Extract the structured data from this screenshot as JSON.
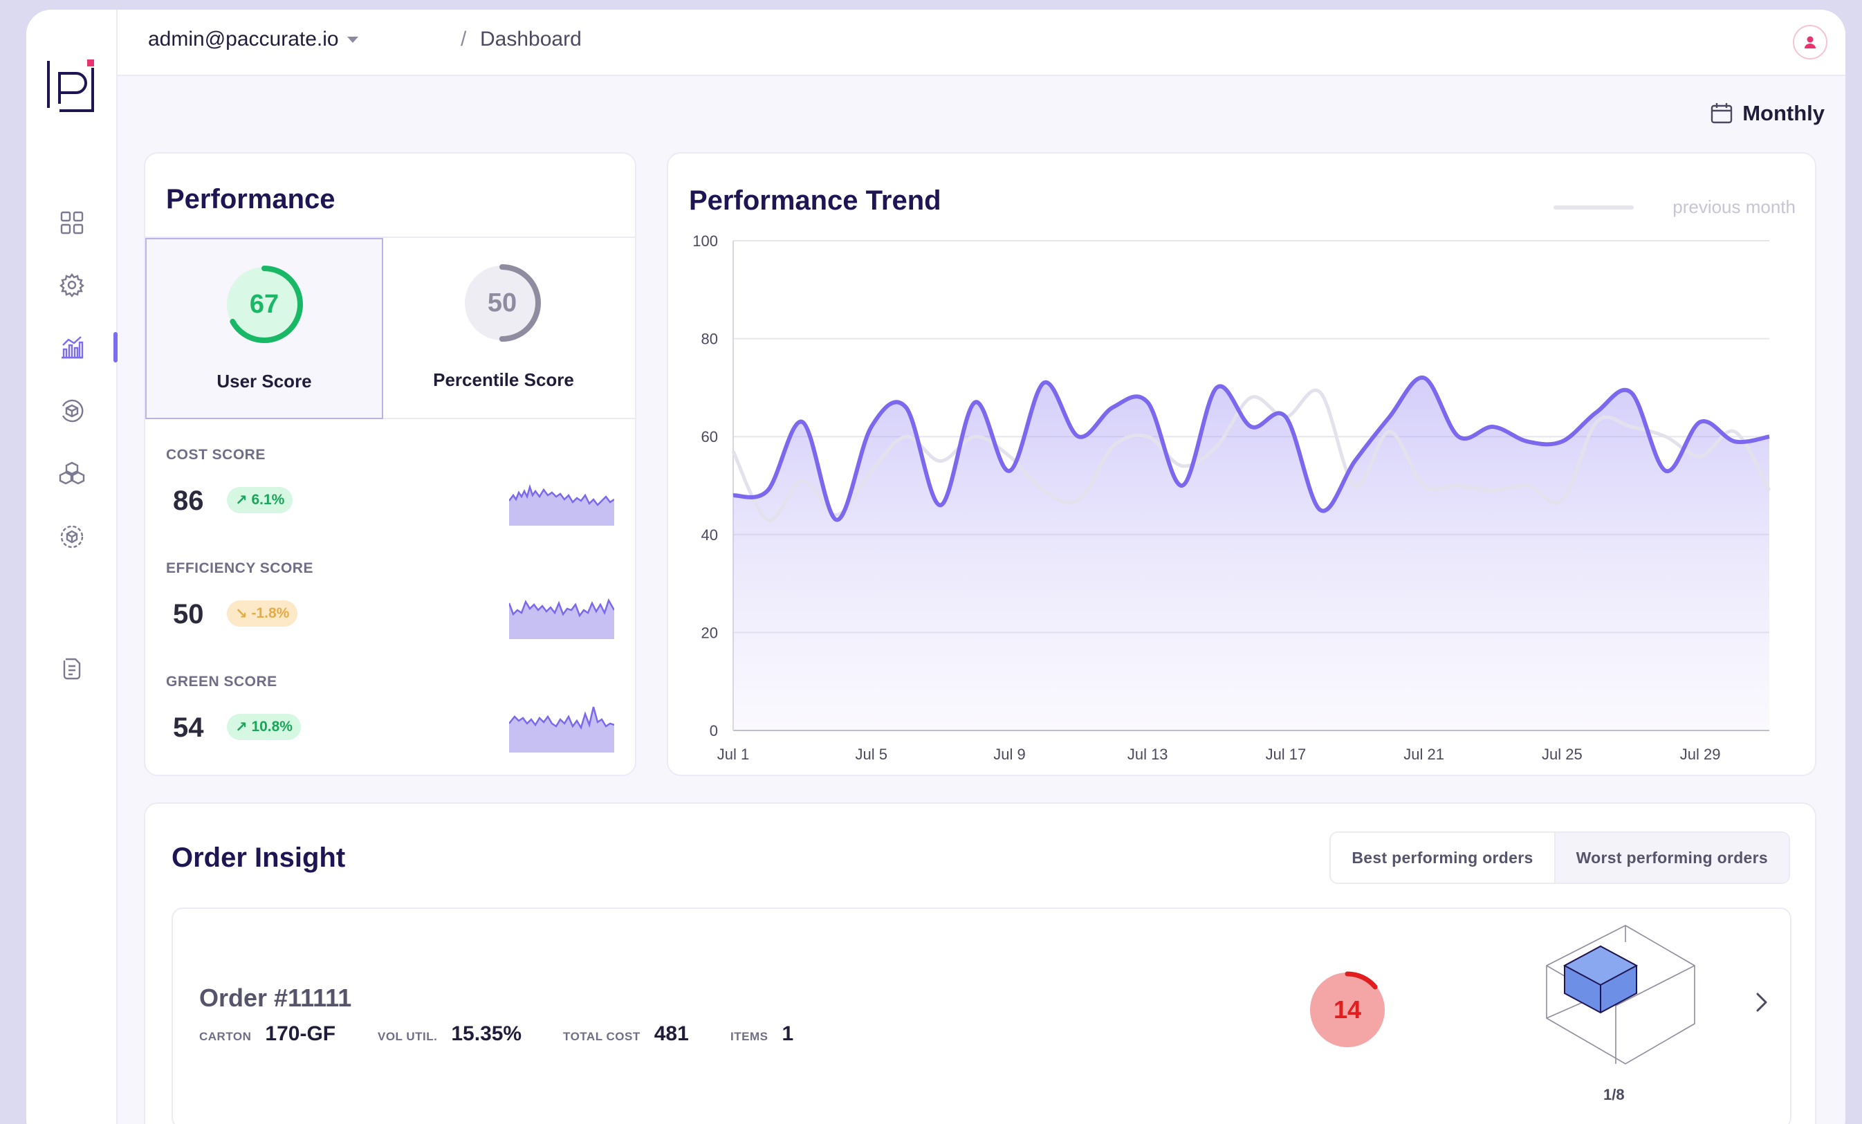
{
  "topbar": {
    "user": "admin@paccurate.io",
    "separator": "/",
    "page": "Dashboard"
  },
  "sidebar": {
    "items": [
      {
        "icon": "dashboard-grid-icon"
      },
      {
        "icon": "gear-icon"
      },
      {
        "icon": "analytics-chart-icon",
        "active": true
      },
      {
        "icon": "package-cycle-icon"
      },
      {
        "icon": "boxes-stack-icon"
      },
      {
        "icon": "package-settings-icon"
      },
      {
        "icon": "documents-icon"
      }
    ]
  },
  "period": {
    "label": "Monthly",
    "icon": "calendar-icon"
  },
  "performance": {
    "title": "Performance",
    "user_score": {
      "value": "67",
      "label": "User Score",
      "fraction": 0.67,
      "color": "#19b867"
    },
    "percentile_score": {
      "value": "50",
      "label": "Percentile Score",
      "fraction": 0.5,
      "color": "#8e8c9e"
    },
    "metrics": [
      {
        "label": "COST SCORE",
        "value": "86",
        "change": "6.1%",
        "direction": "up"
      },
      {
        "label": "EFFICIENCY SCORE",
        "value": "50",
        "change": "-1.8%",
        "direction": "down"
      },
      {
        "label": "GREEN SCORE",
        "value": "54",
        "change": "10.8%",
        "direction": "up"
      }
    ]
  },
  "chart_data": {
    "type": "line",
    "title": "Performance Trend",
    "x": [
      "Jul 1",
      "Jul 2",
      "Jul 3",
      "Jul 4",
      "Jul 5",
      "Jul 6",
      "Jul 7",
      "Jul 8",
      "Jul 9",
      "Jul 10",
      "Jul 11",
      "Jul 12",
      "Jul 13",
      "Jul 14",
      "Jul 15",
      "Jul 16",
      "Jul 17",
      "Jul 18",
      "Jul 19",
      "Jul 20",
      "Jul 21",
      "Jul 22",
      "Jul 23",
      "Jul 24",
      "Jul 25",
      "Jul 26",
      "Jul 27",
      "Jul 28",
      "Jul 29",
      "Jul 30",
      "Jul 31"
    ],
    "xticks": [
      "Jul 1",
      "Jul 5",
      "Jul 9",
      "Jul 13",
      "Jul 17",
      "Jul 21",
      "Jul 25",
      "Jul 29"
    ],
    "yticks": [
      "0",
      "20",
      "40",
      "60",
      "80",
      "100"
    ],
    "ylim": [
      0,
      100
    ],
    "grid": true,
    "legend": "top-right",
    "series": [
      {
        "name": "",
        "color": "#7b68ee",
        "fill": true,
        "values": [
          48,
          49,
          63,
          43,
          62,
          66,
          46,
          67,
          53,
          71,
          60,
          66,
          67,
          50,
          70,
          62,
          64,
          45,
          55,
          64,
          72,
          60,
          62,
          59,
          59,
          65,
          69,
          53,
          63,
          59,
          60
        ]
      },
      {
        "name": "previous month",
        "color": "#e3e2ec",
        "fill": false,
        "values": [
          57,
          43,
          51,
          44,
          53,
          60,
          55,
          60,
          56,
          49,
          47,
          58,
          60,
          54,
          58,
          68,
          64,
          69,
          50,
          61,
          50,
          50,
          49,
          50,
          47,
          63,
          62,
          60,
          56,
          61,
          49
        ]
      }
    ]
  },
  "insight": {
    "title": "Order Insight",
    "tabs": {
      "best": "Best performing orders",
      "worst": "Worst performing orders"
    },
    "order": {
      "title": "Order #11111",
      "fields": [
        {
          "key": "CARTON",
          "value": "170-GF"
        },
        {
          "key": "VOL UTIL.",
          "value": "15.35%"
        },
        {
          "key": "TOTAL COST",
          "value": "481"
        },
        {
          "key": "ITEMS",
          "value": "1"
        }
      ],
      "score": "14",
      "score_fraction": 0.14,
      "pager": "1/8"
    }
  }
}
